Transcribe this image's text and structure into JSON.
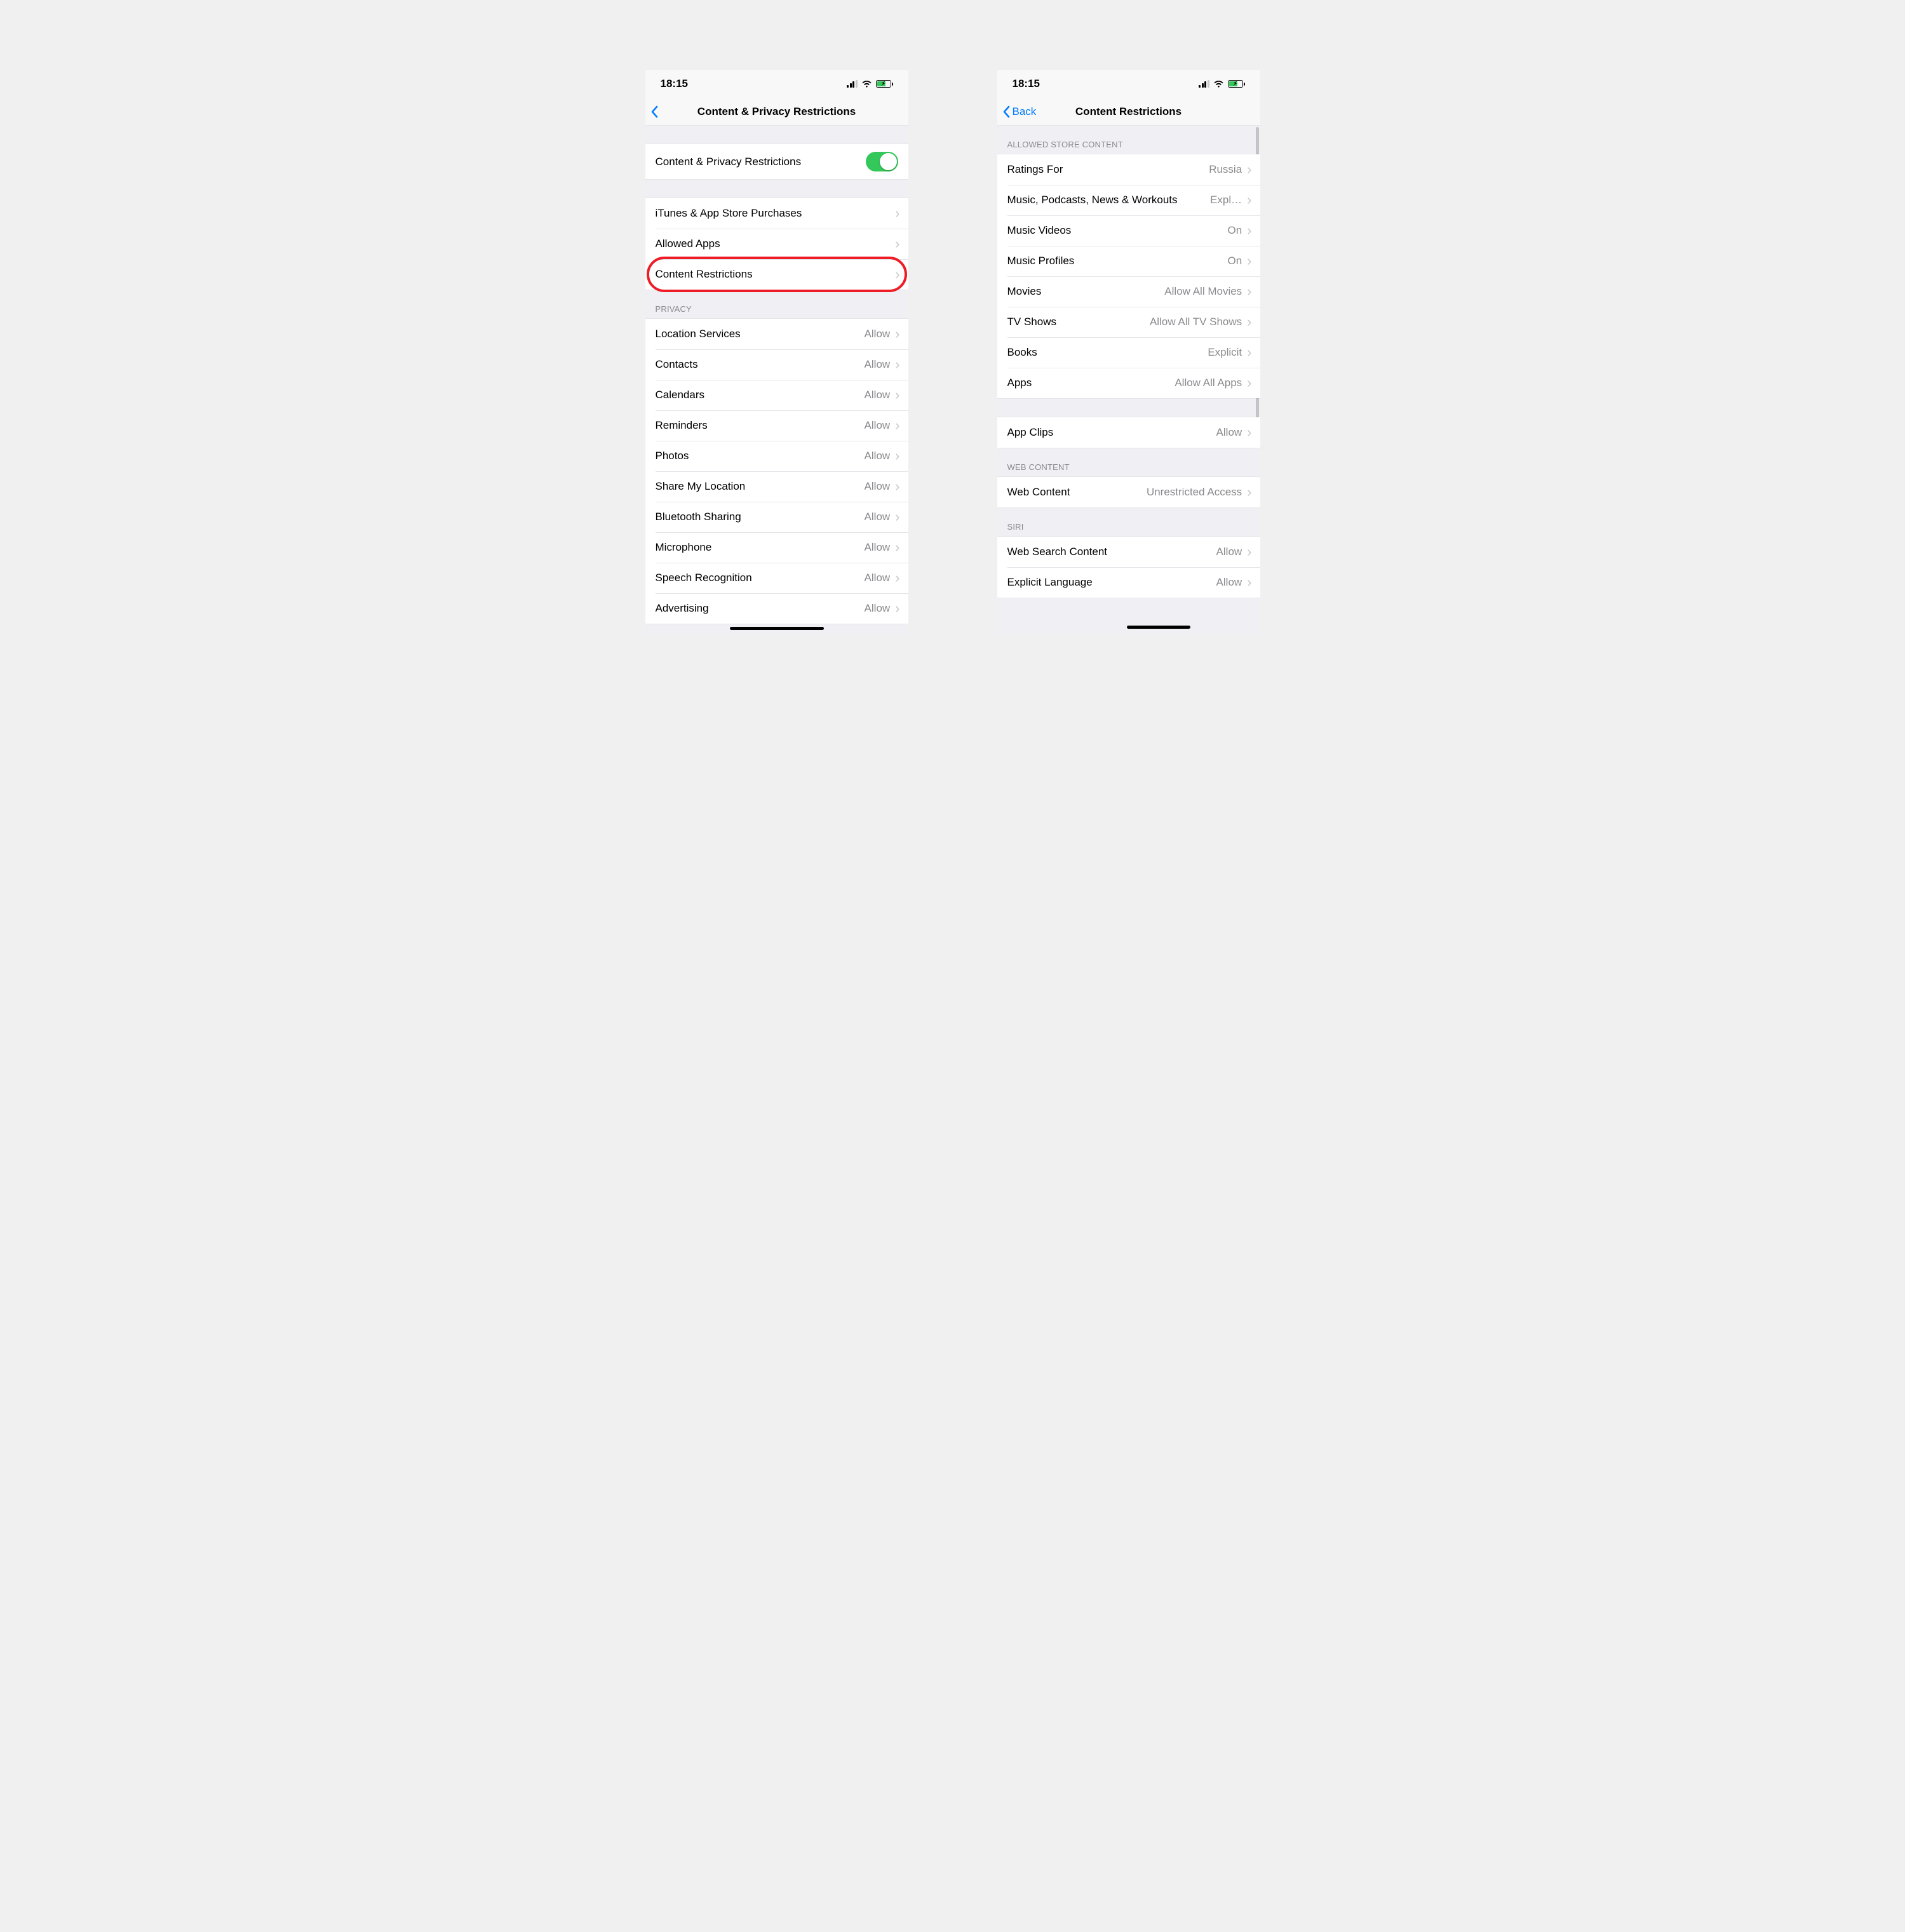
{
  "status": {
    "time": "18:15"
  },
  "phone1": {
    "title": "Content & Privacy Restrictions",
    "toggleLabel": "Content & Privacy Restrictions",
    "nav": {
      "itunes": "iTunes & App Store Purchases",
      "allowedApps": "Allowed Apps",
      "contentRestrictions": "Content Restrictions"
    },
    "privacyHeader": "PRIVACY",
    "privacy": [
      {
        "label": "Location Services",
        "value": "Allow"
      },
      {
        "label": "Contacts",
        "value": "Allow"
      },
      {
        "label": "Calendars",
        "value": "Allow"
      },
      {
        "label": "Reminders",
        "value": "Allow"
      },
      {
        "label": "Photos",
        "value": "Allow"
      },
      {
        "label": "Share My Location",
        "value": "Allow"
      },
      {
        "label": "Bluetooth Sharing",
        "value": "Allow"
      },
      {
        "label": "Microphone",
        "value": "Allow"
      },
      {
        "label": "Speech Recognition",
        "value": "Allow"
      },
      {
        "label": "Advertising",
        "value": "Allow"
      }
    ]
  },
  "phone2": {
    "backLabel": "Back",
    "title": "Content Restrictions",
    "storeHeader": "ALLOWED STORE CONTENT",
    "store": [
      {
        "label": "Ratings For",
        "value": "Russia"
      },
      {
        "label": "Music, Podcasts, News & Workouts",
        "value": "Expl…"
      },
      {
        "label": "Music Videos",
        "value": "On"
      },
      {
        "label": "Music Profiles",
        "value": "On"
      },
      {
        "label": "Movies",
        "value": "Allow All Movies"
      },
      {
        "label": "TV Shows",
        "value": "Allow All TV Shows"
      },
      {
        "label": "Books",
        "value": "Explicit"
      },
      {
        "label": "Apps",
        "value": "Allow All Apps"
      }
    ],
    "appClipsLabel": "App Clips",
    "appClipsValue": "Allow",
    "webHeader": "WEB CONTENT",
    "webContentLabel": "Web Content",
    "webContentValue": "Unrestricted Access",
    "siriHeader": "SIRI",
    "siri": [
      {
        "label": "Web Search Content",
        "value": "Allow"
      },
      {
        "label": "Explicit Language",
        "value": "Allow"
      }
    ]
  }
}
